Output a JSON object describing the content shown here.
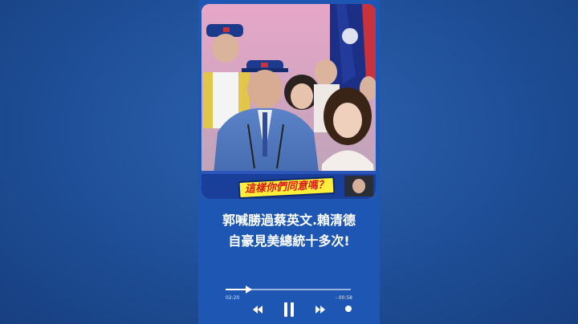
{
  "video": {
    "caption": "這樣你們同意嗎？"
  },
  "headline": {
    "line1": "郭喊勝過蔡英文.賴清德",
    "line2": "自豪見美總統十多次!"
  },
  "player": {
    "elapsed": "02:20",
    "remaining": "- 00:58",
    "progress": 0.17,
    "icons": {
      "rewind": "rewind-icon",
      "pause": "pause-icon",
      "forward": "fast-forward-icon",
      "volume": "volume-dot-icon"
    }
  },
  "colors": {
    "background": "#1f4f98",
    "player": "#1d57b3",
    "caption_bg": "#ffef3a",
    "caption_text": "#d81c1c"
  }
}
